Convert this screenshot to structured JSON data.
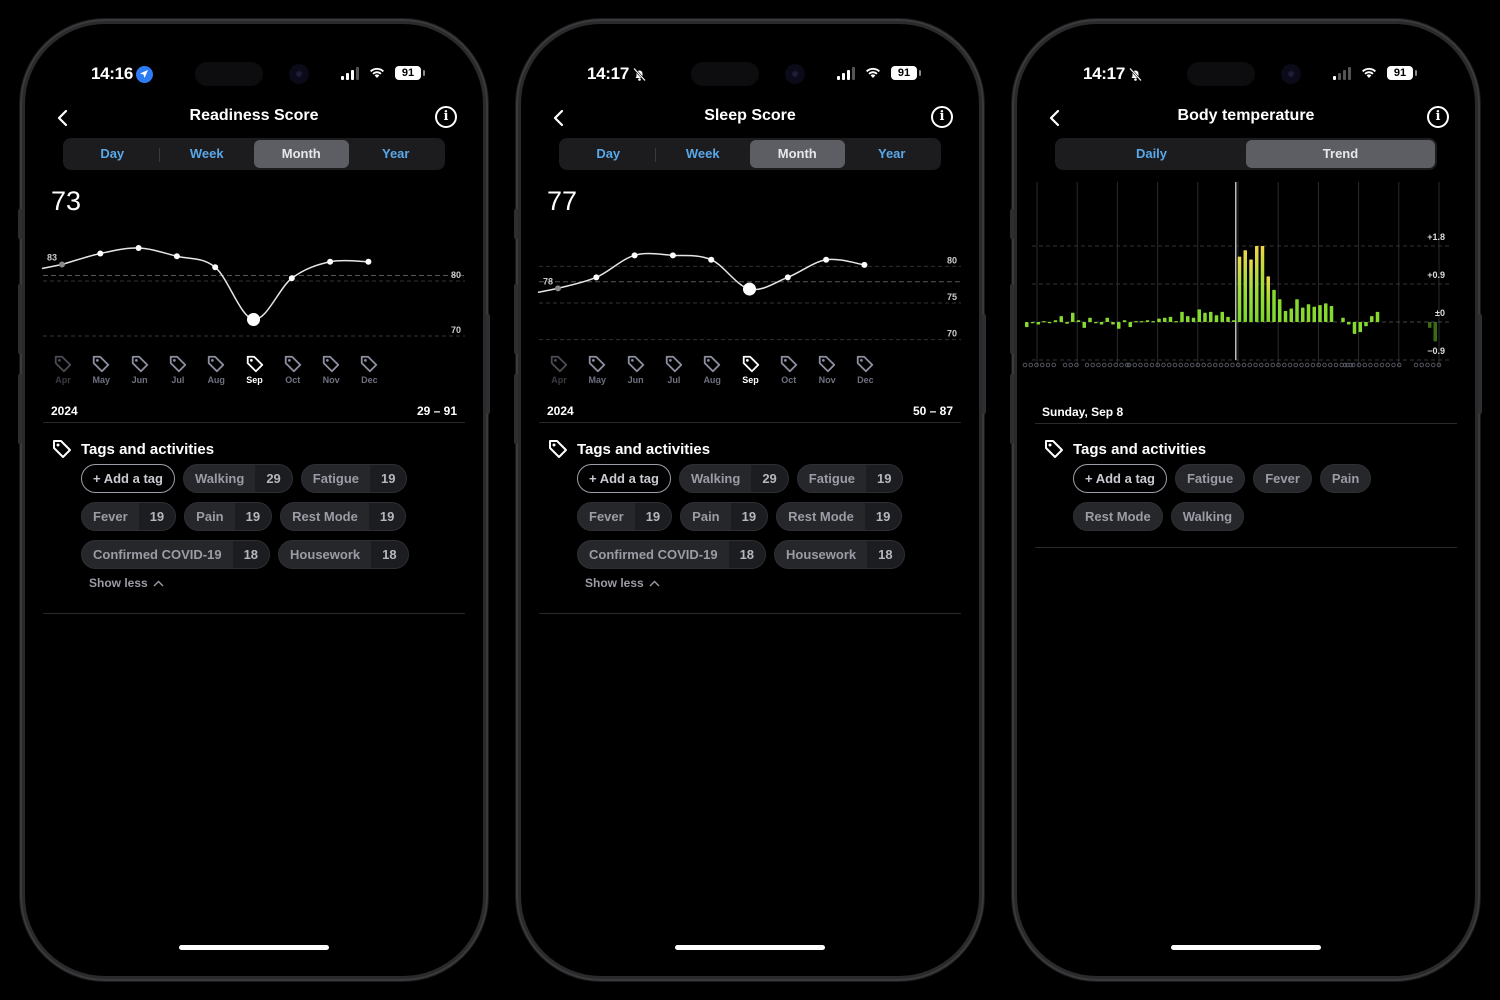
{
  "status_bars": [
    {
      "time": "14:16",
      "indicator": "location-arrow-icon",
      "battery": "91"
    },
    {
      "time": "14:17",
      "indicator": "bell-slash-icon",
      "battery": "91"
    },
    {
      "time": "14:17",
      "indicator": "bell-slash-icon",
      "battery": "91"
    }
  ],
  "screens": {
    "readiness": {
      "title": "Readiness Score",
      "tabs": [
        {
          "label": "Day"
        },
        {
          "label": "Week"
        },
        {
          "label": "Month",
          "active": true
        },
        {
          "label": "Year"
        }
      ],
      "value": "73",
      "year": "2024",
      "range": "29 – 91",
      "months": [
        "Apr",
        "May",
        "Jun",
        "Jul",
        "Aug",
        "Sep",
        "Oct",
        "Nov",
        "Dec"
      ],
      "selected_month": "Sep",
      "start_label": "83",
      "tags_title": "Tags and activities",
      "add_tag": "+ Add a tag",
      "tags": [
        [
          {
            "label": "Walking",
            "count": "29"
          },
          {
            "label": "Fatigue",
            "count": "19"
          }
        ],
        [
          {
            "label": "Fever",
            "count": "19"
          },
          {
            "label": "Pain",
            "count": "19"
          },
          {
            "label": "Rest Mode",
            "count": "19"
          }
        ],
        [
          {
            "label": "Confirmed COVID-19",
            "count": "18"
          },
          {
            "label": "Housework",
            "count": "18"
          }
        ]
      ],
      "show_less": "Show less"
    },
    "sleep": {
      "title": "Sleep Score",
      "tabs": [
        {
          "label": "Day"
        },
        {
          "label": "Week"
        },
        {
          "label": "Month",
          "active": true
        },
        {
          "label": "Year"
        }
      ],
      "value": "77",
      "year": "2024",
      "range": "50 – 87",
      "months": [
        "Apr",
        "May",
        "Jun",
        "Jul",
        "Aug",
        "Sep",
        "Oct",
        "Nov",
        "Dec"
      ],
      "selected_month": "Sep",
      "start_label": "78",
      "tags_title": "Tags and activities",
      "add_tag": "+ Add a tag",
      "tags": [
        [
          {
            "label": "Walking",
            "count": "29"
          },
          {
            "label": "Fatigue",
            "count": "19"
          }
        ],
        [
          {
            "label": "Fever",
            "count": "19"
          },
          {
            "label": "Pain",
            "count": "19"
          },
          {
            "label": "Rest Mode",
            "count": "19"
          }
        ],
        [
          {
            "label": "Confirmed COVID-19",
            "count": "18"
          },
          {
            "label": "Housework",
            "count": "18"
          }
        ]
      ],
      "show_less": "Show less"
    },
    "temperature": {
      "title": "Body temperature",
      "tabs": [
        {
          "label": "Daily"
        },
        {
          "label": "Trend",
          "active": true
        }
      ],
      "date": "Sunday, Sep 8",
      "tags_title": "Tags and activities",
      "add_tag": "+ Add a tag",
      "tags": [
        [
          {
            "label": "Fatigue"
          },
          {
            "label": "Fever"
          },
          {
            "label": "Pain"
          }
        ],
        [
          {
            "label": "Rest Mode"
          },
          {
            "label": "Walking"
          }
        ]
      ]
    }
  },
  "chart_data": [
    {
      "type": "line",
      "title": "Readiness Score",
      "categories": [
        "Apr",
        "May",
        "Jun",
        "Jul",
        "Aug",
        "Sep",
        "Oct",
        "Nov",
        "Dec"
      ],
      "values": [
        83,
        85,
        86,
        84.5,
        82.5,
        73,
        80.5,
        83.5,
        83.5
      ],
      "highlight": "Sep",
      "y_gridlines": [
        {
          "value": 80,
          "label": "80"
        },
        {
          "value": 70,
          "label": "70"
        }
      ],
      "baseline": 81,
      "ylim": [
        68,
        88
      ]
    },
    {
      "type": "line",
      "title": "Sleep Score",
      "categories": [
        "Apr",
        "May",
        "Jun",
        "Jul",
        "Aug",
        "Sep",
        "Oct",
        "Nov",
        "Dec"
      ],
      "values": [
        77,
        78.5,
        81.5,
        81.5,
        80.9,
        76.9,
        78.5,
        80.9,
        80.2
      ],
      "highlight": "Sep",
      "y_gridlines": [
        {
          "value": 80,
          "label": "80"
        },
        {
          "value": 75,
          "label": "75"
        },
        {
          "value": 70,
          "label": "70"
        }
      ],
      "baseline": 77.9,
      "ylim": [
        69,
        84
      ]
    },
    {
      "type": "bar",
      "title": "Body temperature trend",
      "y_ticks": [
        "+1.8",
        "+0.9",
        "±0",
        "−0.9"
      ],
      "ylim": [
        -1.1,
        2.2
      ],
      "values": [
        -0.12,
        0,
        -0.06,
        0.02,
        0,
        0.04,
        0.14,
        -0.04,
        0.22,
        0.04,
        -0.14,
        0.1,
        0,
        -0.06,
        0.1,
        -0.06,
        -0.16,
        0.04,
        -0.12,
        0.02,
        0.02,
        0.04,
        0.02,
        0.08,
        0.1,
        0.12,
        0.02,
        0.24,
        0.14,
        0.1,
        0.3,
        0.22,
        0.24,
        0.16,
        0.24,
        0.12,
        0.04,
        1.55,
        1.7,
        1.48,
        1.8,
        1.8,
        1.08,
        0.76,
        0.54,
        0.26,
        0.32,
        0.54,
        0.34,
        0.42,
        0.36,
        0.4,
        0.44,
        0.38,
        null,
        0.1,
        -0.06,
        -0.28,
        -0.24,
        -0.1,
        0.14,
        0.24,
        null,
        null,
        null,
        null,
        null,
        null,
        null,
        null,
        null,
        null,
        null,
        -0.14,
        -0.46
      ],
      "highlight_index": 37
    }
  ]
}
